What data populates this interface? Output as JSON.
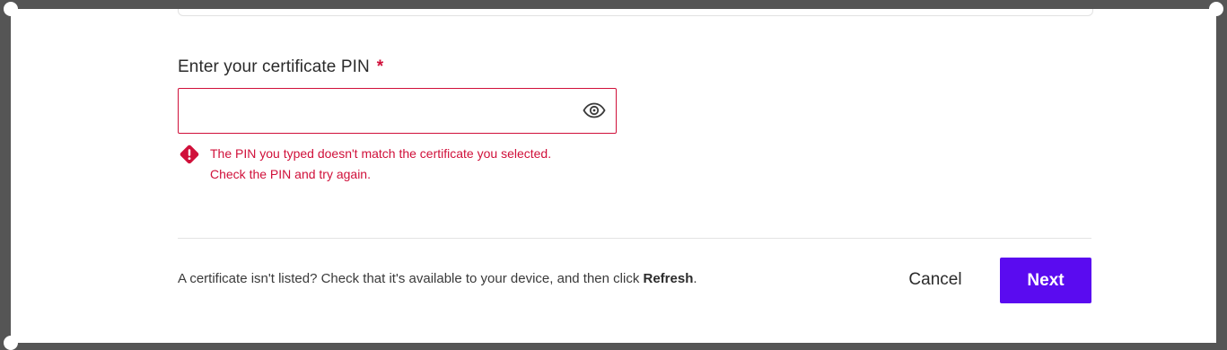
{
  "pin_field": {
    "label": "Enter your certificate PIN",
    "required_marker": "*",
    "value": "",
    "show_icon": "eye-icon"
  },
  "error": {
    "icon": "error-diamond-icon",
    "line1": "The PIN you typed doesn't match the certificate you selected.",
    "line2": "Check the PIN and try again."
  },
  "footer": {
    "note_prefix": "A certificate isn't listed? Check that it's available to your device, and then click ",
    "note_link": "Refresh",
    "note_suffix": ".",
    "cancel_label": "Cancel",
    "next_label": "Next"
  },
  "colors": {
    "accent": "#5a0bf0",
    "error": "#d0103a"
  }
}
